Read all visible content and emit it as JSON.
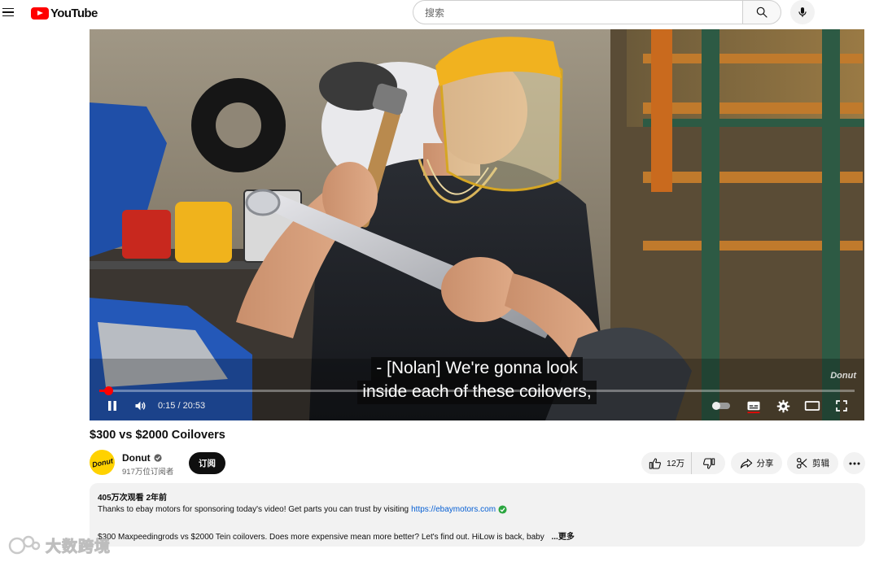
{
  "masthead": {
    "logo_text": "YouTube",
    "search_placeholder": "搜索"
  },
  "player": {
    "captions": [
      "- [Nolan] We're gonna look",
      "inside each of these coilovers,"
    ],
    "time_display": "0:15 / 20:53",
    "progress": 0.012,
    "watermark": "Donut"
  },
  "video": {
    "title": "$300 vs $2000 Coilovers"
  },
  "channel": {
    "avatar_text": "Donut",
    "name": "Donut",
    "subscribers": "917万位订阅者",
    "subscribe_label": "订阅"
  },
  "actions": {
    "like_count": "12万",
    "share_label": "分享",
    "clip_label": "剪辑"
  },
  "description": {
    "meta": "405万次观看  2年前",
    "line1_text": "Thanks to ebay motors for sponsoring today's video! Get parts you can trust by visiting",
    "line1_link": "https://ebaymotors.com",
    "line2_text": "$300 Maxpeedingrods vs $2000 Tein coilovers.  Does more expensive mean more better?  Let's find out. HiLow is back, baby",
    "more_label": "...更多"
  },
  "site_mark": {
    "text": "大数跨境"
  },
  "colors": {
    "brand_red": "#ff0000",
    "link_blue": "#065fd4",
    "verified_green": "#2ba640"
  }
}
